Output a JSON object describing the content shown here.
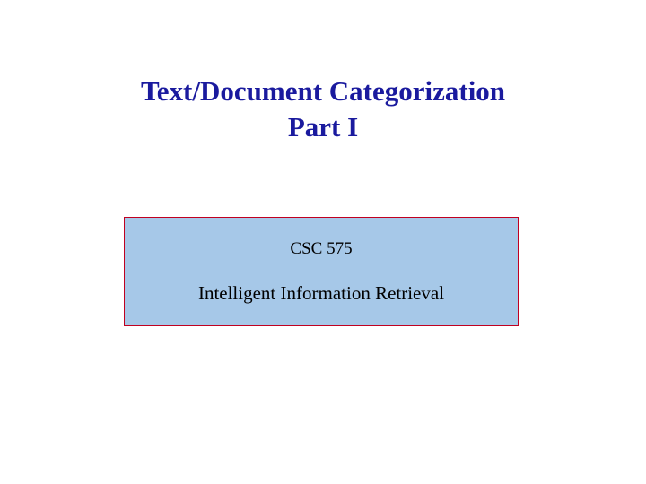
{
  "title": {
    "line1": "Text/Document Categorization",
    "line2": "Part I"
  },
  "course": {
    "code": "CSC 575",
    "name": "Intelligent Information Retrieval"
  }
}
